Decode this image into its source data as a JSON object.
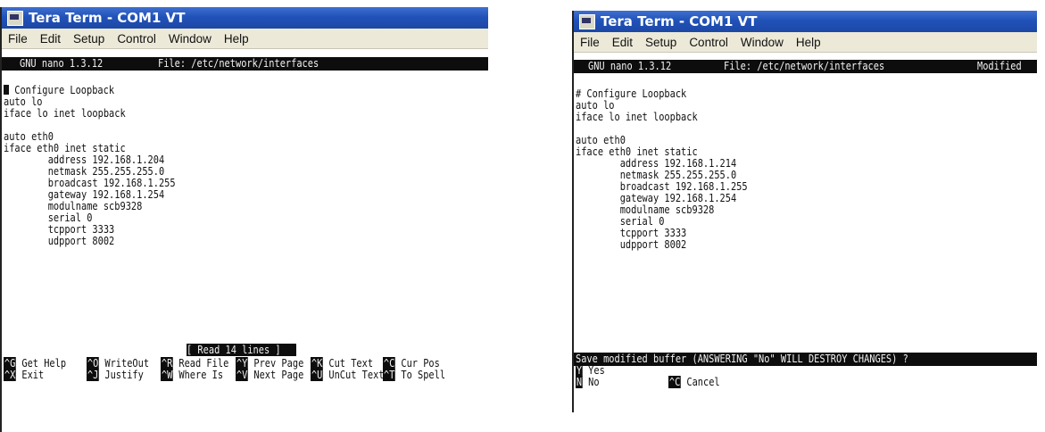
{
  "left": {
    "title": "Tera Term - COM1 VT",
    "menu": [
      "File",
      "Edit",
      "Setup",
      "Control",
      "Window",
      "Help"
    ],
    "status": {
      "app": "GNU nano 1.3.12",
      "file": "File: /etc/network/interfaces"
    },
    "lines": [
      "# Configure Loopback",
      "auto lo",
      "iface lo inet loopback",
      "",
      "auto eth0",
      "iface eth0 inet static",
      "        address 192.168.1.204",
      "        netmask 255.255.255.0",
      "        broadcast 192.168.1.255",
      "        gateway 192.168.1.254",
      "        modulname scb9328",
      "        serial 0",
      "        tcpport 3333",
      "        udpport 8002"
    ],
    "message": "[ Read 14 lines ]",
    "shortcuts": [
      {
        "key": "^G",
        "label": "Get Help"
      },
      {
        "key": "^O",
        "label": "WriteOut"
      },
      {
        "key": "^R",
        "label": "Read File"
      },
      {
        "key": "^Y",
        "label": "Prev Page"
      },
      {
        "key": "^K",
        "label": "Cut Text"
      },
      {
        "key": "^C",
        "label": "Cur Pos"
      },
      {
        "key": "^X",
        "label": "Exit"
      },
      {
        "key": "^J",
        "label": "Justify"
      },
      {
        "key": "^W",
        "label": "Where Is"
      },
      {
        "key": "^V",
        "label": "Next Page"
      },
      {
        "key": "^U",
        "label": "UnCut Text"
      },
      {
        "key": "^T",
        "label": "To Spell"
      }
    ]
  },
  "right": {
    "title": "Tera Term - COM1 VT",
    "menu": [
      "File",
      "Edit",
      "Setup",
      "Control",
      "Window",
      "Help"
    ],
    "status": {
      "app": "GNU nano 1.3.12",
      "file": "File: /etc/network/interfaces",
      "state": "Modified"
    },
    "lines": [
      "# Configure Loopback",
      "auto lo",
      "iface lo inet loopback",
      "",
      "auto eth0",
      "iface eth0 inet static",
      "        address 192.168.1.214",
      "        netmask 255.255.255.0",
      "        broadcast 192.168.1.255",
      "        gateway 192.168.1.254",
      "        modulname scb9328",
      "        serial 0",
      "        tcpport 3333",
      "        udpport 8002"
    ],
    "prompt": "Save modified buffer (ANSWERING \"No\" WILL DESTROY CHANGES) ?",
    "options": [
      {
        "key": "Y",
        "label": "Yes"
      },
      {
        "key": "N",
        "label": "No"
      },
      {
        "key": "^C",
        "label": "Cancel"
      }
    ]
  }
}
